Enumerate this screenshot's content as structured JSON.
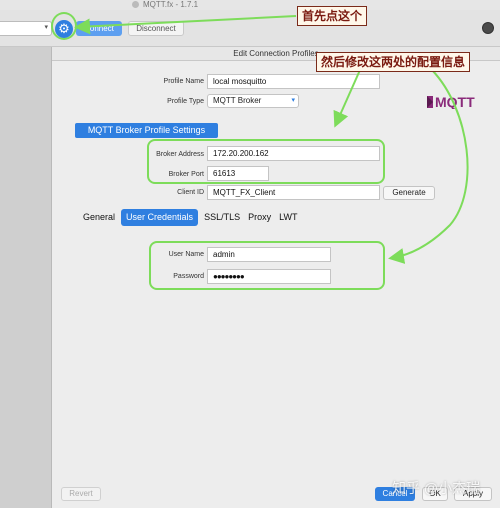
{
  "window": {
    "title": "MQTT.fx - 1.7.1"
  },
  "toolbar": {
    "profile_value": "",
    "connect_label": "Connect",
    "disconnect_label": "Disconnect",
    "status_color": "#4a4a4a"
  },
  "dialog": {
    "title": "Edit Connection Profiles",
    "profile_name_label": "Profile Name",
    "profile_name_value": "local mosquitto",
    "profile_type_label": "Profile Type",
    "profile_type_value": "MQTT Broker",
    "brand_logo_text": "MQTT",
    "broker_section_title": "MQTT Broker Profile Settings",
    "broker_address_label": "Broker Address",
    "broker_address_value": "172.20.200.162",
    "broker_port_label": "Broker Port",
    "broker_port_value": "61613",
    "client_id_label": "Client ID",
    "client_id_value": "MQTT_FX_Client",
    "generate_label": "Generate",
    "tabs": [
      {
        "label": "General",
        "active": false
      },
      {
        "label": "User Credentials",
        "active": true
      },
      {
        "label": "SSL/TLS",
        "active": false
      },
      {
        "label": "Proxy",
        "active": false
      },
      {
        "label": "LWT",
        "active": false
      }
    ],
    "user_name_label": "User Name",
    "user_name_value": "admin",
    "password_label": "Password",
    "password_value": "●●●●●●●●",
    "revert_label": "Revert",
    "cancel_label": "Cancel",
    "ok_label": "OK",
    "apply_label": "Apply"
  },
  "annotations": {
    "callout_1": "首先点这个",
    "callout_2": "然后修改这两处的配置信息",
    "highlight_color": "#7ddc5a",
    "callout_text_color": "#7a1a10"
  },
  "watermark": "知乎 @小杰瑞",
  "colors": {
    "accent": "#2f7fe0",
    "brand": "#8a2a7a"
  },
  "icons": {
    "gear": "gear-icon",
    "caret": "chevron-down-icon"
  }
}
